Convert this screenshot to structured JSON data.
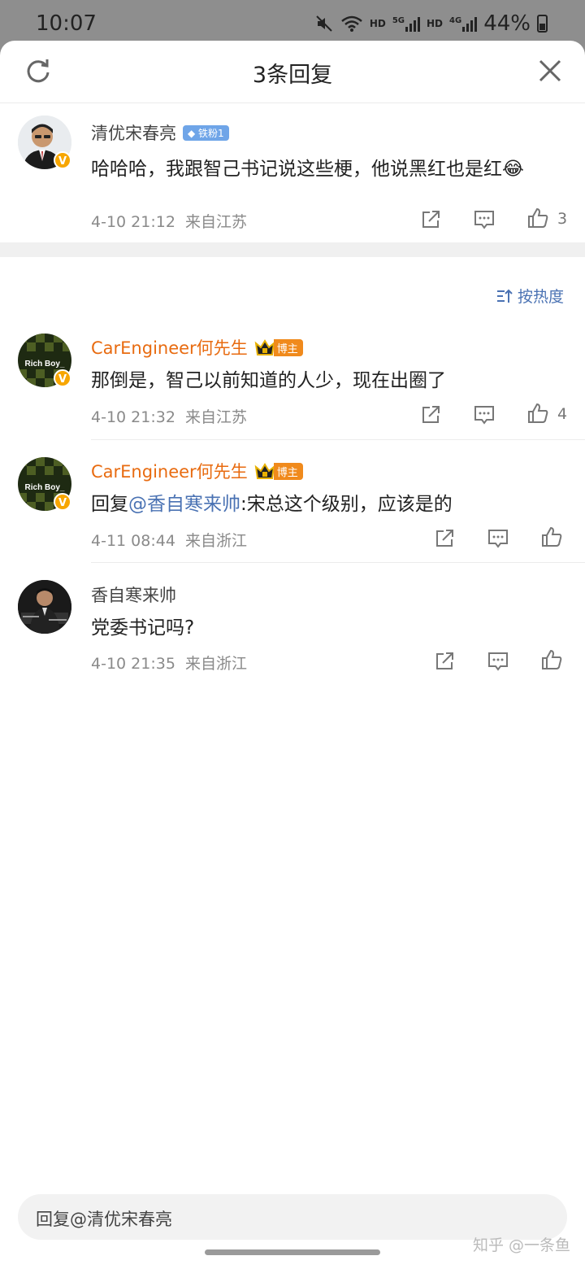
{
  "status_bar": {
    "time": "10:07",
    "net1": "HD",
    "net1_gen": "5G",
    "net2": "HD",
    "net2_gen": "4G",
    "battery": "44%"
  },
  "header": {
    "title": "3条回复"
  },
  "root_comment": {
    "user": "清优宋春亮",
    "badge": "铁粉1",
    "text": "哈哈哈，我跟智己书记说这些梗，他说黑红也是红",
    "emoji": "😂",
    "time": "4-10 21:12",
    "location": "来自江苏",
    "likes": "3"
  },
  "sort_label": "按热度",
  "replies": [
    {
      "user": "CarEngineer何先生",
      "badge": "博主",
      "text": "那倒是，智己以前知道的人少，现在出圈了",
      "time": "4-10 21:32",
      "location": "来自江苏",
      "likes": "4",
      "avatar_text": "Rich Boy_"
    },
    {
      "user": "CarEngineer何先生",
      "badge": "博主",
      "reply_prefix": "回复",
      "mention": "@香自寒来帅",
      "text": ":宋总这个级别，应该是的",
      "time": "4-11 08:44",
      "location": "来自浙江",
      "avatar_text": "Rich Boy_"
    },
    {
      "user": "香自寒来帅",
      "text": "党委书记吗?",
      "time": "4-10 21:35",
      "location": "来自浙江"
    }
  ],
  "input": {
    "placeholder": "回复@清优宋春亮"
  },
  "watermark": "知乎 @一条鱼",
  "colors": {
    "link": "#4a72b3",
    "blogger_name": "#e86b10",
    "blogger_badge": "#f08a1c",
    "fan_badge": "#6fa5e8",
    "verified": "#f7a600"
  }
}
